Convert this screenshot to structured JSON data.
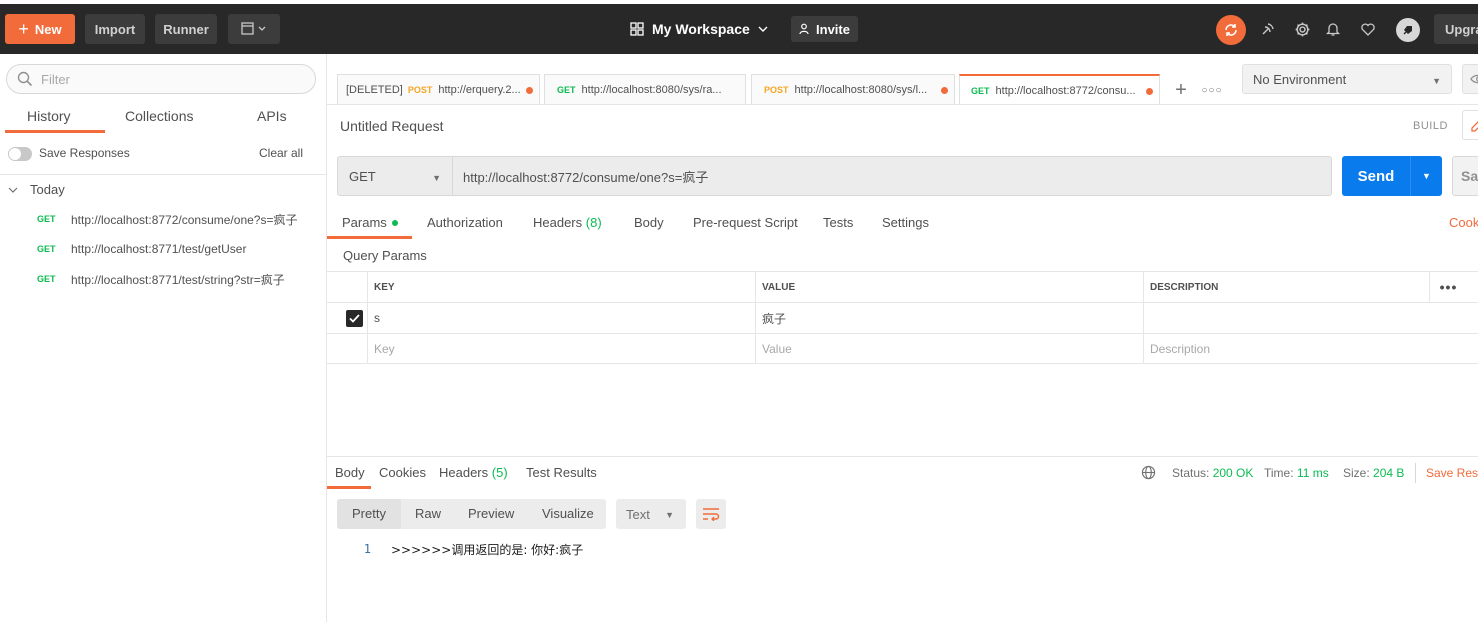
{
  "topbar": {
    "new_label": "New",
    "import_label": "Import",
    "runner_label": "Runner",
    "workspace_label": "My Workspace",
    "invite_label": "Invite",
    "upgrade_label": "Upgrade"
  },
  "sidebar": {
    "filter_placeholder": "Filter",
    "tabs": [
      {
        "label": "History",
        "active": true
      },
      {
        "label": "Collections"
      },
      {
        "label": "APIs"
      }
    ],
    "save_responses_label": "Save Responses",
    "clear_all_label": "Clear all",
    "group_label": "Today",
    "history": [
      {
        "method": "GET",
        "url": "http://localhost:8772/consume/one?s=疯子"
      },
      {
        "method": "GET",
        "url": "http://localhost:8771/test/getUser"
      },
      {
        "method": "GET",
        "url": "http://localhost:8771/test/string?str=疯子"
      }
    ]
  },
  "request_tabs": [
    {
      "prefix": "[DELETED]",
      "method": "POST",
      "url": "http://erquery.2..."
    },
    {
      "prefix": "",
      "method": "GET",
      "url": "http://localhost:8080/sys/ra..."
    },
    {
      "prefix": "",
      "method": "POST",
      "url": "http://localhost:8080/sys/l..."
    },
    {
      "prefix": "",
      "method": "GET",
      "url": "http://localhost:8772/consu..."
    }
  ],
  "environment": {
    "selected": "No Environment"
  },
  "request": {
    "title": "Untitled Request",
    "build_label": "BUILD",
    "method": "GET",
    "url": "http://localhost:8772/consume/one?s=疯子",
    "send_label": "Send",
    "save_label": "Save"
  },
  "request_subtabs": {
    "params": "Params",
    "authorization": "Authorization",
    "headers": "Headers",
    "headers_count": "(8)",
    "body": "Body",
    "prerequest": "Pre-request Script",
    "tests": "Tests",
    "settings": "Settings",
    "cookies": "Cookies"
  },
  "query_params": {
    "title": "Query Params",
    "headers": {
      "key": "KEY",
      "value": "VALUE",
      "description": "DESCRIPTION"
    },
    "rows": [
      {
        "checked": true,
        "key": "s",
        "value": "疯子",
        "description": ""
      }
    ],
    "placeholders": {
      "key": "Key",
      "value": "Value",
      "description": "Description"
    }
  },
  "response": {
    "tabs": {
      "body": "Body",
      "cookies": "Cookies",
      "headers": "Headers",
      "headers_count": "(5)",
      "test_results": "Test Results"
    },
    "status_label": "Status:",
    "status_value": "200 OK",
    "time_label": "Time:",
    "time_value": "11 ms",
    "size_label": "Size:",
    "size_value": "204 B",
    "save_response_label": "Save Response",
    "formats": [
      "Pretty",
      "Raw",
      "Preview",
      "Visualize"
    ],
    "text_type": "Text",
    "lines": [
      {
        "number": "1",
        "text": ">>>>>>调用返回的是: 你好:疯子"
      }
    ]
  },
  "colors": {
    "accent": "#f26b3a",
    "send_blue": "#097bed",
    "get_green": "#0cbb52",
    "post_orange": "#f5a623",
    "topbar_bg": "#282828"
  }
}
